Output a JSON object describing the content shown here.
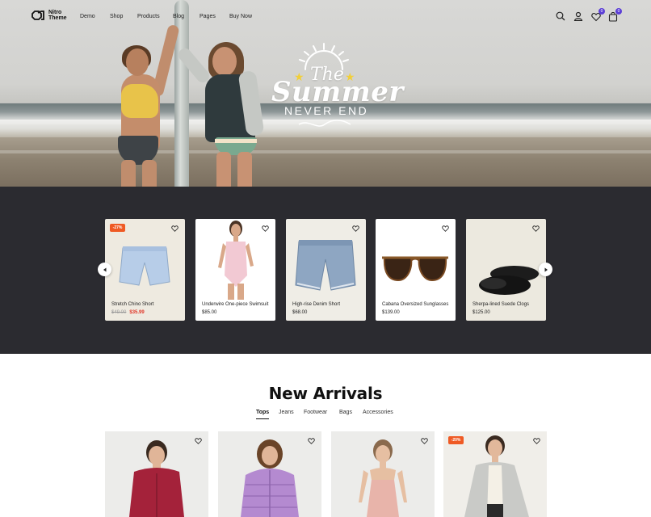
{
  "header": {
    "logo_line1": "Nitro",
    "logo_line2": "Theme",
    "nav": [
      "Demo",
      "Shop",
      "Products",
      "Blog",
      "Pages",
      "Buy Now"
    ],
    "wishlist_count": "0",
    "cart_count": "0"
  },
  "hero": {
    "title_the": "The",
    "title_summer": "Summer",
    "subtitle": "NEVER END"
  },
  "carousel": {
    "products": [
      {
        "name": "Stretch Chino Short",
        "old_price": "$49.00",
        "price": "$35.99",
        "badge": "-27%",
        "bg": "#eeeae0"
      },
      {
        "name": "Underwire One-piece Swimsuit",
        "price": "$85.00",
        "bg": "#ffffff"
      },
      {
        "name": "High-rise Denim Short",
        "price": "$68.00",
        "bg": "#efede6"
      },
      {
        "name": "Cabana Oversized Sunglasses",
        "price": "$139.00",
        "bg": "#ffffff"
      },
      {
        "name": "Sherpa-lined Suede Clogs",
        "price": "$125.00",
        "bg": "#ece9df"
      }
    ]
  },
  "new_arrivals": {
    "title": "New Arrivals",
    "tabs": [
      "Tops",
      "Jeans",
      "Footwear",
      "Bags",
      "Accessories"
    ],
    "active_tab": "Tops",
    "cards": [
      {
        "badge": ""
      },
      {
        "badge": ""
      },
      {
        "badge": ""
      },
      {
        "badge": "-20%"
      }
    ]
  },
  "colors": {
    "accent": "#5b3ed6",
    "sale": "#e0382a",
    "badge": "#ef5a24",
    "dark_band": "#2b2b30"
  }
}
